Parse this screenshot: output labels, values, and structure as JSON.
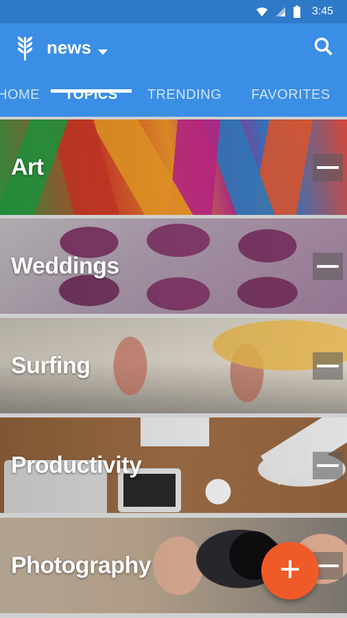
{
  "status_bar": {
    "time": "3:45",
    "icons": [
      "wifi-icon",
      "signal-icon",
      "battery-icon"
    ]
  },
  "app_bar": {
    "title": "news",
    "logo_icon": "wheat-logo-icon",
    "dropdown_icon": "chevron-down-icon",
    "search_icon": "search-icon",
    "colors": {
      "primary": "#3b8ee6",
      "status": "#2f79c9"
    }
  },
  "tabs": [
    {
      "label": "HOME",
      "active": false
    },
    {
      "label": "TOPICS",
      "active": true
    },
    {
      "label": "TRENDING",
      "active": false
    },
    {
      "label": "FAVORITES",
      "active": false
    }
  ],
  "topics": [
    {
      "label": "Art",
      "action_icon": "minus-icon"
    },
    {
      "label": "Weddings",
      "action_icon": "minus-icon"
    },
    {
      "label": "Surfing",
      "action_icon": "minus-icon"
    },
    {
      "label": "Productivity",
      "action_icon": "minus-icon"
    },
    {
      "label": "Photography",
      "action_icon": "minus-icon"
    }
  ],
  "fab": {
    "icon": "plus-icon",
    "color": "#f05a28"
  }
}
